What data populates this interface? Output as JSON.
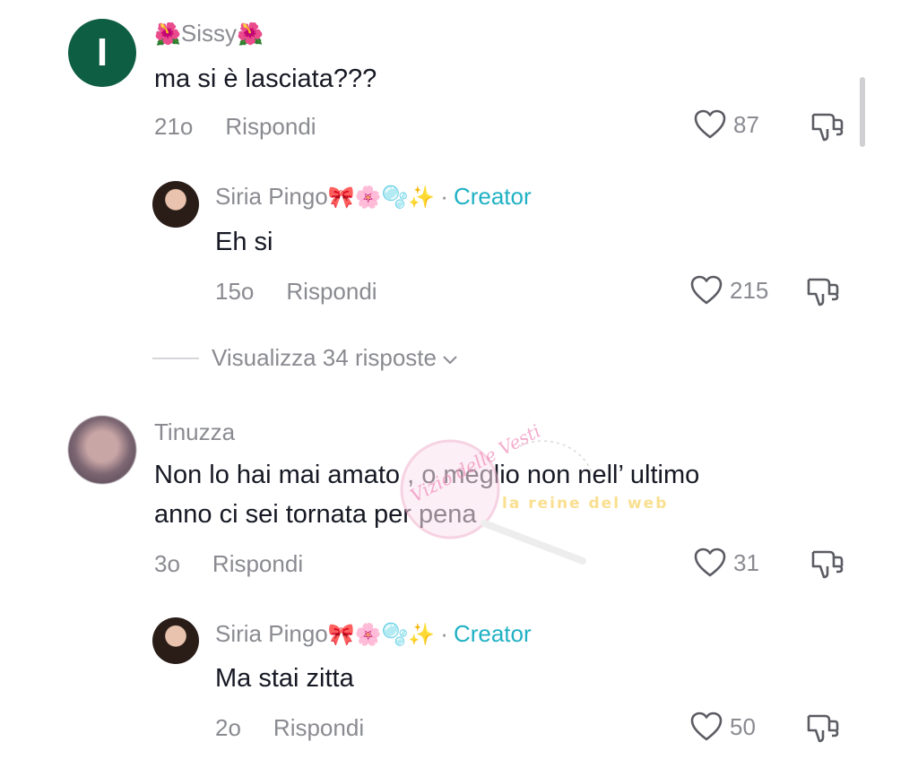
{
  "comments": [
    {
      "user": "Sissy",
      "emoji_left": "🌺",
      "emoji_right": "🌺",
      "avatar_letter": "I",
      "text": "ma si è lasciata???",
      "time": "21o",
      "reply_label": "Rispondi",
      "likes": "87"
    },
    {
      "user": "Siria Pingo",
      "emojis": "🎀🌸🫧✨",
      "badge": "Creator",
      "separator": "·",
      "text": "Eh si",
      "time": "15o",
      "reply_label": "Rispondi",
      "likes": "215"
    },
    {
      "user": "Tinuzza",
      "text_line1": "Non lo hai mai amato , o meglio non nell’ ultimo",
      "text_line2": "anno ci sei tornata per pena",
      "time": "3o",
      "reply_label": "Rispondi",
      "likes": "31"
    },
    {
      "user": "Siria Pingo",
      "emojis": "🎀🌸🫧✨",
      "badge": "Creator",
      "separator": "·",
      "text": "Ma stai zitta",
      "time": "2o",
      "reply_label": "Rispondi",
      "likes": "50"
    }
  ],
  "view_replies": {
    "label": "Visualizza 34 risposte",
    "chevron": "⌄"
  },
  "watermark": {
    "left": "Vizio delle Vesti",
    "right": "la reine del web"
  },
  "colors": {
    "creator": "#20b1c4",
    "muted": "#8a8b91",
    "text": "#161823",
    "avatar_green": "#0e5e44"
  }
}
